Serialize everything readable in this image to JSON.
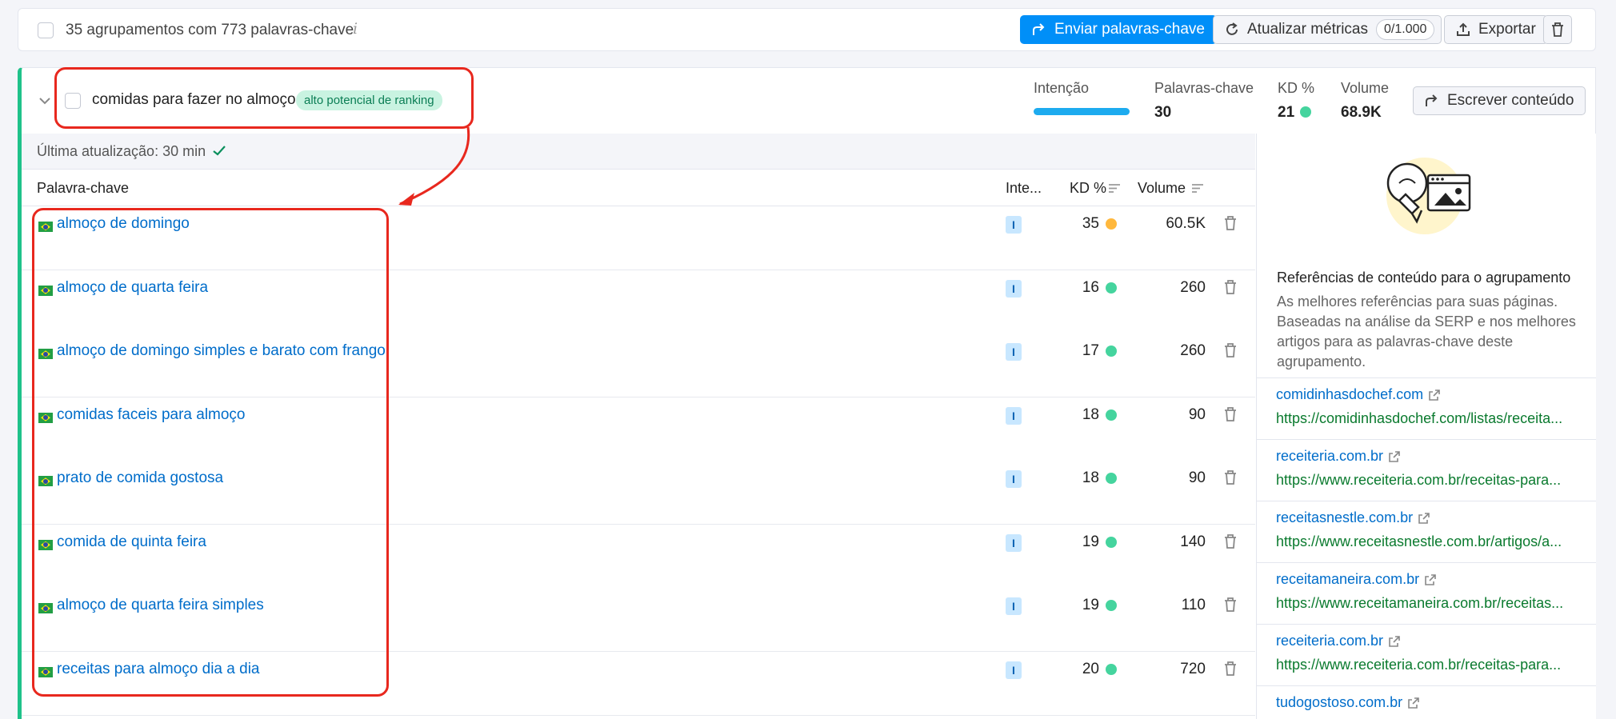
{
  "toolbar": {
    "summary": "35 agrupamentos com 773 palavras-chave",
    "info_icon": "info-icon",
    "send_label": "Enviar palavras-chave",
    "update_label": "Atualizar métricas",
    "update_count": "0/1.000",
    "export_label": "Exportar"
  },
  "cluster": {
    "name": "comidas para fazer no almoço",
    "badge": "alto potencial de ranking",
    "metrics": {
      "intent_label": "Intenção",
      "keywords_label": "Palavras-chave",
      "keywords_value": "30",
      "kd_label": "KD %",
      "kd_value": "21",
      "volume_label": "Volume",
      "volume_value": "68.9K"
    },
    "write_label": "Escrever conteúdo"
  },
  "updated": {
    "text": "Última atualização: 30 min"
  },
  "table": {
    "col_keyword": "Palavra-chave",
    "col_intent": "Inte...",
    "col_kd": "KD %",
    "col_volume": "Volume",
    "rows": [
      {
        "keyword": "almoço de domingo",
        "intent": "I",
        "kd": "35",
        "kd_color": "#ffb83d",
        "volume": "60.5K"
      },
      {
        "keyword": "almoço de quarta feira",
        "intent": "I",
        "kd": "16",
        "kd_color": "#45d49e",
        "volume": "260"
      },
      {
        "keyword": "almoço de domingo simples e barato com frango",
        "intent": "I",
        "kd": "17",
        "kd_color": "#45d49e",
        "volume": "260"
      },
      {
        "keyword": "comidas faceis para almoço",
        "intent": "I",
        "kd": "18",
        "kd_color": "#45d49e",
        "volume": "90"
      },
      {
        "keyword": "prato de comida gostosa",
        "intent": "I",
        "kd": "18",
        "kd_color": "#45d49e",
        "volume": "90"
      },
      {
        "keyword": "comida de quinta feira",
        "intent": "I",
        "kd": "19",
        "kd_color": "#45d49e",
        "volume": "140"
      },
      {
        "keyword": "almoço de quarta feira simples",
        "intent": "I",
        "kd": "19",
        "kd_color": "#45d49e",
        "volume": "110"
      },
      {
        "keyword": "receitas para almoço dia a dia",
        "intent": "I",
        "kd": "20",
        "kd_color": "#45d49e",
        "volume": "720"
      }
    ]
  },
  "references": {
    "title": "Referências de conteúdo para o agrupamento",
    "description": "As melhores referências para suas páginas. Baseadas na análise da SERP e nos melhores artigos para as palavras-chave deste agrupamento.",
    "items": [
      {
        "domain": "comidinhasdochef.com",
        "url": "https://comidinhasdochef.com/listas/receita..."
      },
      {
        "domain": "receiteria.com.br",
        "url": "https://www.receiteria.com.br/receitas-para..."
      },
      {
        "domain": "receitasnestle.com.br",
        "url": "https://www.receitasnestle.com.br/artigos/a..."
      },
      {
        "domain": "receitamaneira.com.br",
        "url": "https://www.receitamaneira.com.br/receitas..."
      },
      {
        "domain": "receiteria.com.br",
        "url": "https://www.receiteria.com.br/receitas-para..."
      },
      {
        "domain": "tudogostoso.com.br",
        "url": ""
      }
    ]
  },
  "colors": {
    "accent_blue": "#008ff8",
    "link_blue": "#006dca",
    "url_green": "#0a7a2e",
    "cluster_border": "#1fc28a",
    "highlight_red": "#e8281e"
  }
}
